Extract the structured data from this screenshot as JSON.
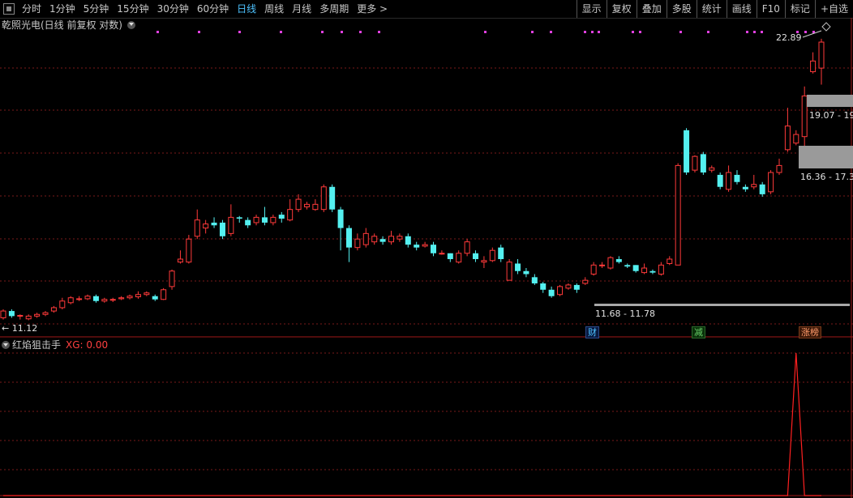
{
  "toolbar": {
    "periods": [
      "分时",
      "1分钟",
      "5分钟",
      "15分钟",
      "30分钟",
      "60分钟",
      "日线",
      "周线",
      "月线",
      "多周期",
      "更多 >"
    ],
    "active_period": "日线",
    "buttons": [
      "显示",
      "复权",
      "叠加",
      "多股",
      "统计",
      "画线",
      "F10",
      "标记",
      "+自选"
    ]
  },
  "chart": {
    "title": "乾照光电(日线 前复权 对数)",
    "high_label": "22.89",
    "low_label": "11.12",
    "support_label": "11.68 - 11.78",
    "zone1_label": "19.07 - 19",
    "zone2_label": "16.36 - 17.3",
    "tags": [
      {
        "text": "财",
        "color": "#4ec3ff"
      },
      {
        "text": "减",
        "color": "#6cd36c"
      },
      {
        "text": "涨榜",
        "color": "#ff9a6a"
      }
    ],
    "colors": {
      "up": "#ff3a3a",
      "down": "#54f0f0",
      "grid": "#7a1a1a",
      "signal": "#ff2020",
      "dots": "#e040e0"
    }
  },
  "indicator": {
    "name": "红焰狙击手",
    "value_text": "XG: 0.00"
  },
  "candles": [
    [
      11.25,
      11.45,
      11.5,
      11.2
    ],
    [
      11.45,
      11.3,
      11.5,
      11.25
    ],
    [
      11.3,
      11.32,
      11.35,
      11.2
    ],
    [
      11.22,
      11.3,
      11.35,
      11.18
    ],
    [
      11.3,
      11.35,
      11.4,
      11.25
    ],
    [
      11.35,
      11.4,
      11.45,
      11.3
    ],
    [
      11.45,
      11.55,
      11.6,
      11.4
    ],
    [
      11.55,
      11.75,
      11.85,
      11.5
    ],
    [
      11.7,
      11.85,
      11.9,
      11.65
    ],
    [
      11.8,
      11.82,
      11.9,
      11.75
    ],
    [
      11.82,
      11.9,
      11.95,
      11.78
    ],
    [
      11.9,
      11.75,
      11.95,
      11.7
    ],
    [
      11.75,
      11.8,
      11.85,
      11.7
    ],
    [
      11.78,
      11.8,
      11.85,
      11.72
    ],
    [
      11.82,
      11.85,
      11.9,
      11.78
    ],
    [
      11.85,
      11.9,
      11.95,
      11.8
    ],
    [
      11.88,
      11.95,
      12.05,
      11.82
    ],
    [
      11.95,
      12.0,
      12.05,
      11.9
    ],
    [
      11.9,
      11.8,
      11.95,
      11.75
    ],
    [
      11.8,
      12.1,
      12.15,
      11.78
    ],
    [
      12.2,
      12.7,
      12.75,
      12.1
    ],
    [
      13.0,
      13.1,
      13.4,
      12.95
    ],
    [
      13.0,
      13.8,
      13.95,
      12.95
    ],
    [
      13.9,
      14.5,
      14.9,
      13.8
    ],
    [
      14.2,
      14.35,
      14.5,
      14.0
    ],
    [
      14.4,
      14.3,
      14.6,
      14.2
    ],
    [
      14.4,
      13.9,
      14.5,
      13.8
    ],
    [
      14.0,
      14.6,
      15.1,
      13.9
    ],
    [
      14.6,
      14.55,
      14.65,
      14.4
    ],
    [
      14.5,
      14.3,
      14.6,
      14.2
    ],
    [
      14.4,
      14.6,
      14.7,
      14.3
    ],
    [
      14.6,
      14.4,
      15.0,
      14.3
    ],
    [
      14.4,
      14.6,
      14.7,
      14.3
    ],
    [
      14.7,
      14.55,
      14.8,
      14.4
    ],
    [
      14.5,
      14.9,
      15.3,
      14.45
    ],
    [
      14.9,
      15.3,
      15.5,
      14.8
    ],
    [
      15.0,
      15.1,
      15.2,
      14.9
    ],
    [
      14.9,
      15.1,
      15.3,
      14.85
    ],
    [
      14.9,
      15.8,
      15.9,
      14.8
    ],
    [
      15.8,
      14.9,
      15.9,
      14.8
    ],
    [
      14.9,
      14.2,
      15.0,
      13.4
    ],
    [
      14.2,
      13.5,
      14.3,
      13.0
    ],
    [
      13.5,
      13.8,
      14.0,
      13.4
    ],
    [
      13.6,
      14.0,
      14.2,
      13.5
    ],
    [
      13.7,
      13.9,
      14.0,
      13.6
    ],
    [
      13.8,
      13.7,
      13.9,
      13.6
    ],
    [
      13.7,
      13.9,
      14.1,
      13.6
    ],
    [
      13.8,
      13.9,
      14.0,
      13.7
    ],
    [
      13.9,
      13.6,
      14.0,
      13.5
    ],
    [
      13.6,
      13.5,
      13.7,
      13.4
    ],
    [
      13.55,
      13.6,
      13.7,
      13.5
    ],
    [
      13.6,
      13.3,
      13.7,
      13.2
    ],
    [
      13.3,
      13.3,
      13.4,
      13.25
    ],
    [
      13.3,
      13.1,
      13.3,
      13.0
    ],
    [
      13.0,
      13.3,
      13.4,
      12.95
    ],
    [
      13.3,
      13.7,
      13.8,
      13.2
    ],
    [
      13.3,
      13.1,
      13.4,
      13.0
    ],
    [
      13.0,
      13.05,
      13.2,
      12.8
    ],
    [
      13.05,
      13.4,
      13.5,
      13.0
    ],
    [
      13.5,
      13.1,
      13.6,
      13.0
    ],
    [
      12.4,
      13.0,
      13.1,
      12.4
    ],
    [
      12.95,
      12.7,
      13.1,
      12.6
    ],
    [
      12.7,
      12.6,
      12.8,
      12.5
    ],
    [
      12.5,
      12.3,
      12.6,
      12.25
    ],
    [
      12.3,
      12.1,
      12.35,
      12.0
    ],
    [
      12.1,
      11.9,
      12.2,
      11.85
    ],
    [
      11.95,
      12.2,
      12.25,
      11.9
    ],
    [
      12.15,
      12.25,
      12.3,
      12.1
    ],
    [
      12.25,
      12.1,
      12.3,
      12.0
    ],
    [
      12.3,
      12.4,
      12.5,
      12.25
    ],
    [
      12.6,
      12.9,
      13.0,
      12.55
    ],
    [
      12.9,
      12.9,
      13.0,
      12.8
    ],
    [
      12.8,
      13.15,
      13.2,
      12.75
    ],
    [
      13.1,
      13.0,
      13.2,
      12.95
    ],
    [
      12.9,
      12.85,
      12.95,
      12.8
    ],
    [
      12.9,
      12.7,
      12.9,
      12.65
    ],
    [
      12.65,
      12.8,
      12.95,
      12.6
    ],
    [
      12.7,
      12.65,
      12.75,
      12.6
    ],
    [
      12.6,
      12.9,
      13.0,
      12.55
    ],
    [
      12.95,
      13.1,
      13.2,
      12.9
    ],
    [
      12.9,
      16.7,
      16.8,
      12.9
    ],
    [
      18.3,
      16.4,
      18.4,
      16.3
    ],
    [
      16.5,
      17.1,
      17.15,
      16.4
    ],
    [
      17.2,
      16.4,
      17.3,
      16.3
    ],
    [
      16.5,
      16.6,
      16.7,
      16.4
    ],
    [
      16.3,
      15.8,
      16.4,
      15.7
    ],
    [
      15.7,
      16.4,
      16.7,
      15.6
    ],
    [
      16.3,
      16.0,
      16.5,
      15.9
    ],
    [
      15.8,
      15.7,
      15.9,
      15.6
    ],
    [
      15.8,
      15.9,
      16.3,
      15.7
    ],
    [
      15.9,
      15.5,
      16.0,
      15.4
    ],
    [
      15.6,
      16.4,
      16.5,
      15.5
    ],
    [
      16.4,
      16.7,
      17.0,
      16.3
    ],
    [
      17.4,
      18.5,
      19.4,
      17.3
    ],
    [
      17.7,
      18.1,
      18.3,
      17.6
    ],
    [
      18.0,
      20.0,
      20.5,
      17.5
    ],
    [
      21.3,
      21.9,
      22.4,
      21.2
    ],
    [
      21.5,
      23.0,
      23.2,
      20.6
    ]
  ],
  "signal_values": [
    0,
    0,
    0,
    0,
    0,
    0,
    0,
    0,
    0,
    0,
    0,
    0,
    0,
    0,
    0,
    0,
    0,
    0,
    0,
    0,
    0,
    0,
    0,
    0,
    0,
    0,
    0,
    0,
    0,
    0,
    0,
    0,
    0,
    0,
    0,
    0,
    0,
    0,
    0,
    0,
    0,
    0,
    0,
    0,
    0,
    0,
    0,
    0,
    0,
    0,
    0,
    0,
    0,
    0,
    0,
    0,
    0,
    0,
    0,
    0,
    0,
    0,
    0,
    0,
    0,
    0,
    0,
    0,
    0,
    0,
    0,
    0,
    0,
    0,
    0,
    0,
    0,
    0,
    0,
    0,
    0,
    0,
    0,
    0,
    0,
    0,
    0,
    0,
    0,
    0,
    0,
    0,
    0,
    0,
    1,
    0,
    0,
    0
  ]
}
